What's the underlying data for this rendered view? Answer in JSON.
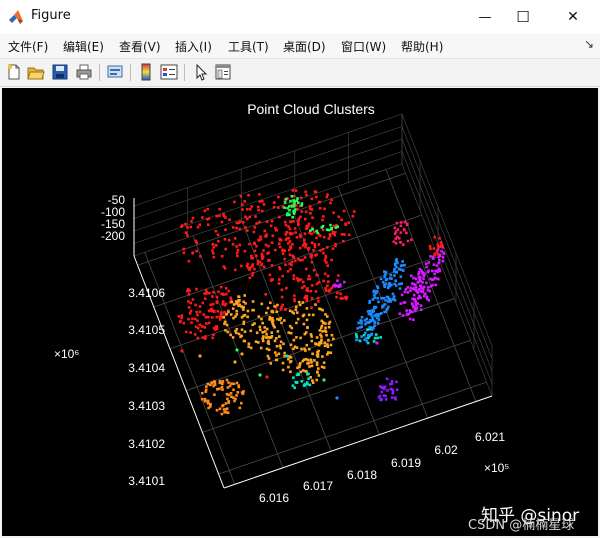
{
  "window": {
    "title": "Figure",
    "minimize_glyph": "—",
    "maximize_glyph": "☐",
    "close_glyph": "✕",
    "app_icon": "matlab-logo-icon"
  },
  "menubar": {
    "items": [
      "文件(F)",
      "编辑(E)",
      "查看(V)",
      "插入(I)",
      "工具(T)",
      "桌面(D)",
      "窗口(W)",
      "帮助(H)"
    ],
    "overflow_glyph": "↘"
  },
  "toolbar": {
    "icons": [
      "new-figure-icon",
      "open-file-icon",
      "save-icon",
      "print-icon",
      "link-plot-icon",
      "insert-colorbar-icon",
      "insert-legend-icon",
      "edit-plot-arrow-icon",
      "property-inspector-icon"
    ]
  },
  "chart_data": {
    "type": "scatter",
    "title": "Point Cloud Clusters",
    "xlabel": "",
    "ylabel": "",
    "zlabel": "",
    "x_exponent": "×10⁵",
    "y_exponent": "×10⁶",
    "x_ticks": [
      "6.016",
      "6.017",
      "6.018",
      "6.019",
      "6.02",
      "6.021"
    ],
    "y_ticks": [
      "3.4101",
      "3.4102",
      "3.4103",
      "3.4104",
      "3.4105",
      "3.4106"
    ],
    "z_ticks": [
      "-50",
      "-100",
      "-150",
      "-200"
    ],
    "grid": true,
    "background": "#000000",
    "axis_color": "#ffffff",
    "cluster_colors": [
      "#ff1a1a",
      "#ff8c1a",
      "#ffa51f",
      "#22ff55",
      "#00e8c0",
      "#1a8cff",
      "#d41aff",
      "#8a1aff",
      "#ff1a6a"
    ]
  },
  "watermark": {
    "zhihu": "知乎 @sinor",
    "csdn": "CSDN @楠楠星球"
  }
}
